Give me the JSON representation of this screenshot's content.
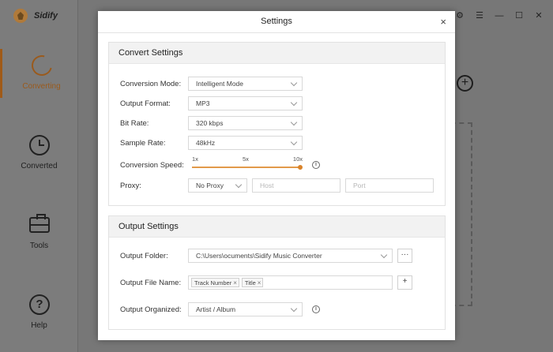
{
  "app": {
    "name": "Sidify",
    "nav": [
      {
        "label": "Converting",
        "icon": "converting-icon"
      },
      {
        "label": "Converted",
        "icon": "clock-icon"
      },
      {
        "label": "Tools",
        "icon": "toolbox-icon"
      },
      {
        "label": "Help",
        "icon": "help-icon"
      }
    ],
    "help_glyph": "?",
    "controls": {
      "settings": "⚙",
      "menu": "☰",
      "minimize": "—",
      "maximize": "☐",
      "close": "✕"
    },
    "add_glyph": "+"
  },
  "dialog": {
    "title": "Settings",
    "close": "×",
    "convert": {
      "heading": "Convert Settings",
      "mode_label": "Conversion Mode:",
      "mode_value": "Intelligent Mode",
      "format_label": "Output Format:",
      "format_value": "MP3",
      "bitrate_label": "Bit Rate:",
      "bitrate_value": "320 kbps",
      "samplerate_label": "Sample Rate:",
      "samplerate_value": "48kHz",
      "speed_label": "Conversion Speed:",
      "speed_marks": [
        "1x",
        "5x",
        "10x"
      ],
      "speed_value": "10x",
      "proxy_label": "Proxy:",
      "proxy_value": "No Proxy",
      "host_placeholder": "Host",
      "port_placeholder": "Port",
      "info_glyph": "i"
    },
    "output": {
      "heading": "Output Settings",
      "folder_label": "Output Folder:",
      "folder_value": "C:\\Users\\ocuments\\Sidify Music Converter",
      "browse_label": "···",
      "filename_label": "Output File Name:",
      "filename_tags": [
        "Track Number",
        "Title"
      ],
      "tag_remove": "×",
      "add_label": "+",
      "organized_label": "Output Organized:",
      "organized_value": "Artist / Album",
      "info_glyph": "i"
    }
  }
}
